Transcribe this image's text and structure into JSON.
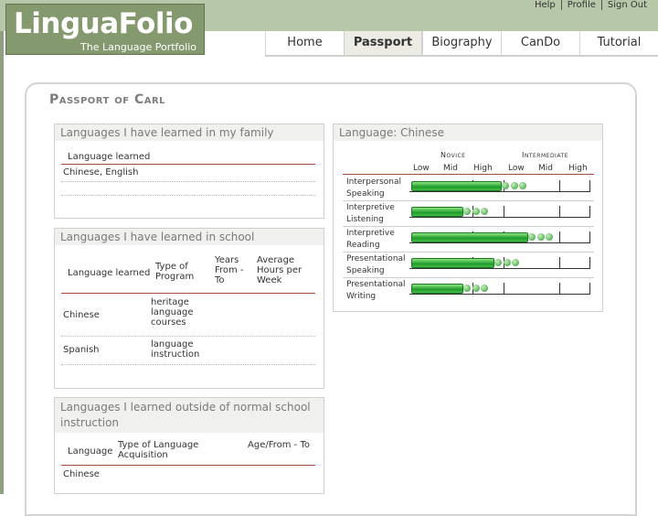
{
  "app": {
    "logo_name": "LinguaFolio",
    "logo_tagline": "The Language Portfolio",
    "top_links": [
      "Help",
      "Profile",
      "Sign Out"
    ]
  },
  "tabs": [
    "Home",
    "Passport",
    "Biography",
    "CanDo",
    "Tutorial"
  ],
  "active_tab": "Passport",
  "page_title": "Passport of Carl",
  "family": {
    "title": "Languages I have learned in my family",
    "header": "Language learned",
    "value": "Chinese, English"
  },
  "school": {
    "title": "Languages I have learned in school",
    "headers": [
      "Language learned",
      "Type of Program",
      "Years From - To",
      "Average Hours per Week"
    ],
    "rows": [
      {
        "language": "Chinese",
        "program": "heritage language courses"
      },
      {
        "language": "Spanish",
        "program": "language instruction"
      }
    ]
  },
  "outside": {
    "title": "Languages I learned outside of normal school instruction",
    "headers": [
      "Language",
      "Type of Language Acquisition",
      "Age/From - To"
    ],
    "rows": [
      {
        "language": "Chinese"
      }
    ]
  },
  "chart": {
    "title": "Language: Chinese",
    "level_groups": [
      "Novice",
      "Intermediate"
    ],
    "sublevels": [
      "Low",
      "Mid",
      "High",
      "Low",
      "Mid",
      "High"
    ],
    "rows": [
      {
        "skill": "Interpersonal Speaking",
        "level": 0.49
      },
      {
        "skill": "Interpretive Listening",
        "level": 0.28
      },
      {
        "skill": "Interpretive Reading",
        "level": 0.64
      },
      {
        "skill": "Presentational Speaking",
        "level": 0.45
      },
      {
        "skill": "Presentational Writing",
        "level": 0.28
      }
    ]
  }
}
